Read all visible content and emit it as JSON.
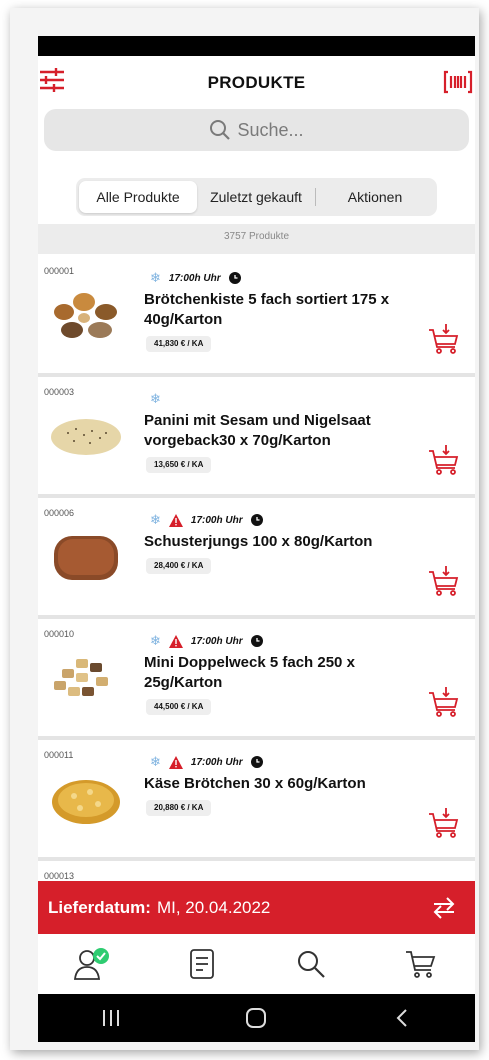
{
  "header": {
    "title": "PRODUKTE"
  },
  "search": {
    "placeholder": "Suche..."
  },
  "tabs": [
    {
      "label": "Alle Produkte",
      "active": true
    },
    {
      "label": "Zuletzt gekauft",
      "active": false
    },
    {
      "label": "Aktionen",
      "active": false
    }
  ],
  "product_count": "3757 Produkte",
  "products": [
    {
      "id": "000001",
      "time": "17:00h Uhr",
      "frozen": true,
      "warning": false,
      "name_line1": "Brötchenkiste 5 fach sortiert 175 x",
      "name_line2": "40g/Karton",
      "price": "41,830 € / KA"
    },
    {
      "id": "000003",
      "time": "",
      "frozen": true,
      "warning": false,
      "name_line1": "Panini mit Sesam und Nigelsaat",
      "name_line2": "vorgeback30 x 70g/Karton",
      "price": "13,650 € / KA"
    },
    {
      "id": "000006",
      "time": "17:00h Uhr",
      "frozen": true,
      "warning": true,
      "name_line1": "Schusterjungs 100 x 80g/Karton",
      "name_line2": "",
      "price": "28,400 € / KA"
    },
    {
      "id": "000010",
      "time": "17:00h Uhr",
      "frozen": true,
      "warning": true,
      "name_line1": "Mini Doppelweck 5 fach 250 x",
      "name_line2": "25g/Karton",
      "price": "44,500 € / KA"
    },
    {
      "id": "000011",
      "time": "17:00h Uhr",
      "frozen": true,
      "warning": true,
      "name_line1": "Käse Brötchen 30 x 60g/Karton",
      "name_line2": "",
      "price": "20,880 € / KA"
    },
    {
      "id": "000013"
    }
  ],
  "delivery": {
    "label": "Lieferdatum:",
    "date": "MI, 20.04.2022"
  },
  "colors": {
    "accent": "#d61f2a",
    "check": "#2ecc71"
  },
  "icons": {
    "filter": "sliders-icon",
    "scan": "barcode-scan-icon",
    "search": "search-icon",
    "frozen": "snowflake-icon",
    "warning": "warning-triangle-icon",
    "clock": "clock-icon",
    "cart": "add-to-cart-icon",
    "swap": "swap-arrows-icon",
    "nav": [
      "account-icon",
      "orders-icon",
      "search-icon",
      "cart-icon"
    ]
  }
}
